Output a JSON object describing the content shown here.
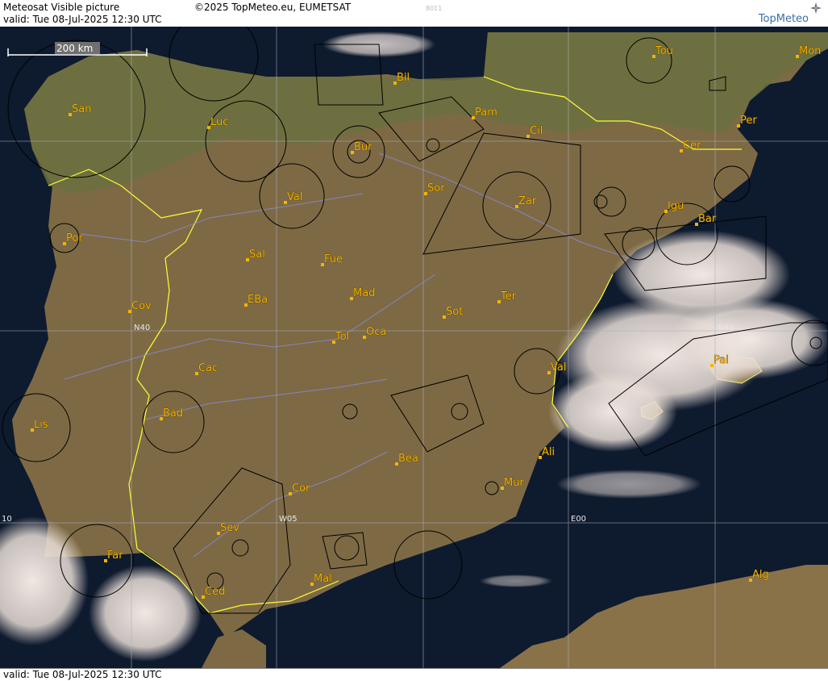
{
  "header": {
    "title": "Meteosat Visible picture",
    "copyright": "©2025 TopMeteo.eu, EUMETSAT",
    "code": "8011",
    "valid": "valid:  Tue  08-Jul-2025  12:30 UTC",
    "logo": "TopMeteo"
  },
  "footer": {
    "valid": "valid:  Tue  08-Jul-2025  12:30 UTC"
  },
  "scale_bar": {
    "label": "200 km"
  },
  "grid_labels": {
    "lat_north": "N40",
    "lat_east": "N40",
    "lon_w10": "10",
    "lon_w05": "W05",
    "lon_e00": "E00"
  },
  "cities": [
    {
      "name": "San"
    },
    {
      "name": "Luc"
    },
    {
      "name": "Bil"
    },
    {
      "name": "Pam"
    },
    {
      "name": "Tou"
    },
    {
      "name": "Mon"
    },
    {
      "name": "Bur"
    },
    {
      "name": "Cil"
    },
    {
      "name": "Per"
    },
    {
      "name": "Cer"
    },
    {
      "name": "Por"
    },
    {
      "name": "Val"
    },
    {
      "name": "Sor"
    },
    {
      "name": "Zar"
    },
    {
      "name": "Igu"
    },
    {
      "name": "Bar"
    },
    {
      "name": "Sal"
    },
    {
      "name": "Fue"
    },
    {
      "name": "Mad"
    },
    {
      "name": "EBa"
    },
    {
      "name": "Cov"
    },
    {
      "name": "Ter"
    },
    {
      "name": "Sot"
    },
    {
      "name": "Tol"
    },
    {
      "name": "Oca"
    },
    {
      "name": "Pal"
    },
    {
      "name": "Cac"
    },
    {
      "name": "Val"
    },
    {
      "name": "Bad"
    },
    {
      "name": "Lis"
    },
    {
      "name": "Ali"
    },
    {
      "name": "Bea"
    },
    {
      "name": "Mur"
    },
    {
      "name": "Cor"
    },
    {
      "name": "Sev"
    },
    {
      "name": "Far"
    },
    {
      "name": "Mal"
    },
    {
      "name": "Ced"
    },
    {
      "name": "Alg"
    }
  ],
  "colors": {
    "land": "#7d6a45",
    "land_green": "#6b7040",
    "sea": "#0e1a2e",
    "coast": "#ffff33",
    "label": "#f5b400",
    "cloud": "#f0e6e0",
    "grid": "#aab0c0",
    "river": "#8a8ae0"
  }
}
